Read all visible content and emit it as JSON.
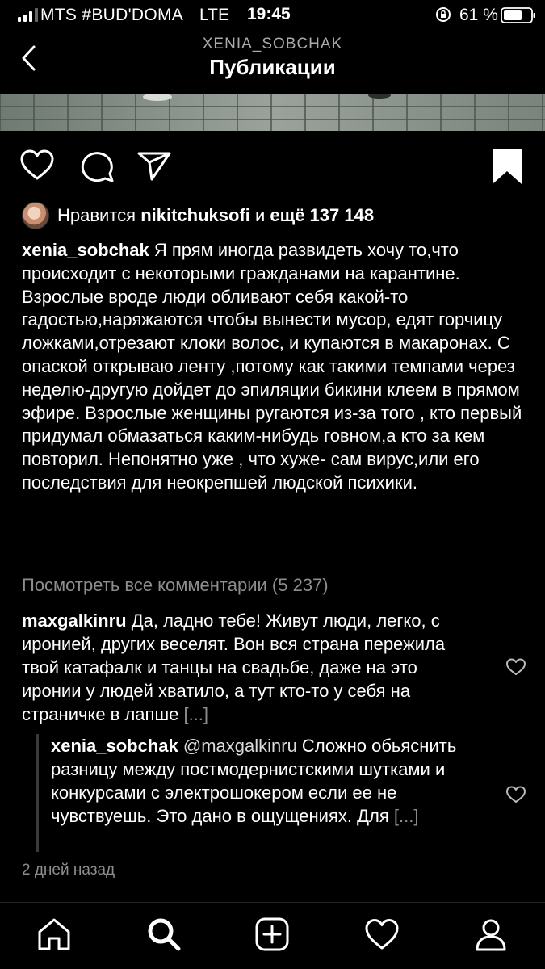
{
  "status_bar": {
    "carrier": "MTS #BUD'DOMA",
    "network": "LTE",
    "time": "19:45",
    "battery": "61 %"
  },
  "header": {
    "username": "XENIA_SOBCHAK",
    "title": "Публикации"
  },
  "post": {
    "likes_prefix": "Нравится ",
    "likes_user": "nikitchuksofi",
    "likes_middle": " и ",
    "likes_more": "ещё 137 148",
    "author": "xenia_sobchak",
    "caption_text": " Я прям иногда развидеть хочу то,что происходит с некоторыми гражданами на карантине. Взрослые вроде люди  обливают себя какой-то гадостью,наряжаются чтобы вынести мусор, едят горчицу ложками,отрезают клоки волос, и купаются в макаронах. С опаской открываю ленту ,потому как такими темпами через неделю-другую дойдет до эпиляции бикини клеем в прямом эфире. Взрослые женщины ругаются из-за того , кто первый придумал обмазаться каким-нибудь говном,а кто за кем повторил. Непонятно уже , что хуже- сам вирус,или его последствия для неокрепшей людской психики.",
    "view_all_comments": "Посмотреть все комментарии (5 237)",
    "timestamp": "2 дней назад"
  },
  "comments": [
    {
      "author": "maxgalkinru",
      "text": " Да, ладно тебе! Живут люди, легко, с иронией, других веселят. Вон вся страна пережила твой катафалк и танцы на свадьбе, даже на это иронии у людей хватило, а тут кто-то у себя на страничке в лапше ",
      "more": "[...]"
    },
    {
      "author": "xenia_sobchak",
      "mention": " @maxgalkinru",
      "text": " Сложно обьяснить разницу между постмодернистскими шутками и конкурсами с электрошокером если ее не чувствуешь. Это дано в ощущениях. Для ",
      "more": "[...]"
    }
  ],
  "colors": {
    "background": "#000000",
    "secondary_text": "#8e8e8e"
  }
}
